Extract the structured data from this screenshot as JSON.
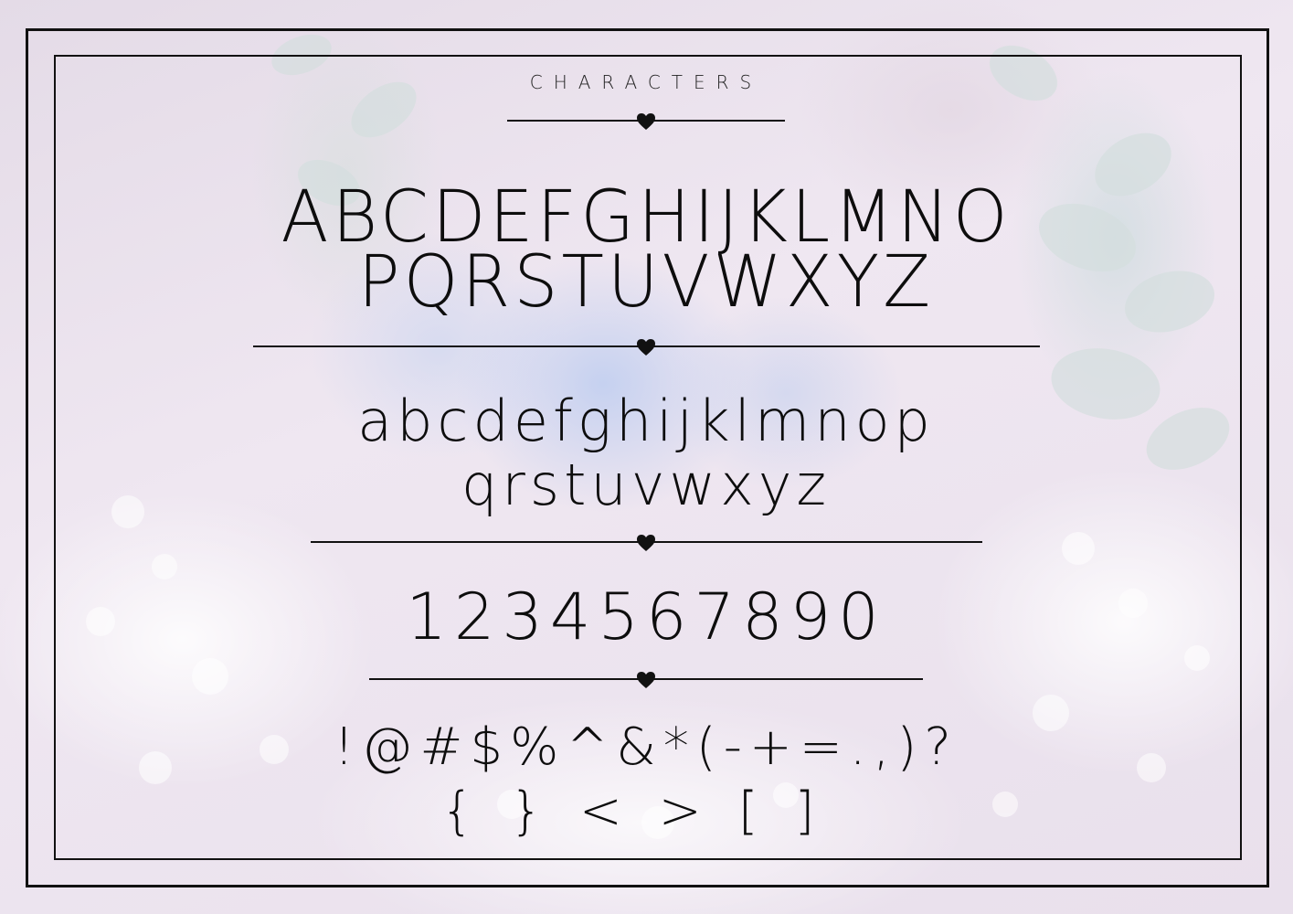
{
  "title": "CHARACTERS",
  "uppercase": {
    "line1": "ABCDEFGHIJKLMNO",
    "line2": "PQRSTUVWXYZ"
  },
  "lowercase": {
    "line1": "abcdefghijklmnop",
    "line2": "qrstuvwxyz"
  },
  "numerals": "1234567890",
  "symbols": {
    "line1": "!@#$%^&*(-+=.,)?",
    "line2": "{}<>[]"
  },
  "colors": {
    "ink": "#111111",
    "background": "#ede4ef",
    "hydrangea": "#c3cfef"
  },
  "ornament_icon": "heart-icon"
}
